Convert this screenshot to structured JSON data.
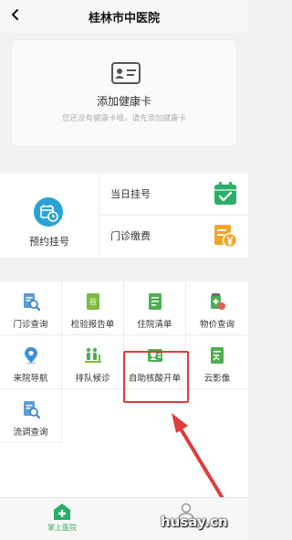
{
  "header": {
    "title": "桂林市中医院",
    "back_icon": "chevron-left-icon"
  },
  "health_card": {
    "title": "添加健康卡",
    "subtitle": "您还没有健康卡哦，请先添加健康卡",
    "icon": "id-card-icon"
  },
  "appointment": {
    "label": "预约挂号",
    "icon": "calendar-clock-icon"
  },
  "side_items": [
    {
      "label": "当日挂号",
      "icon": "calendar-check-icon"
    },
    {
      "label": "门诊缴费",
      "icon": "yen-payment-icon"
    }
  ],
  "services": [
    {
      "label": "门诊查询",
      "icon": "doc-search-icon",
      "color": "#5b9bd5"
    },
    {
      "label": "检验报告单",
      "icon": "test-report-icon",
      "color": "#4caf50"
    },
    {
      "label": "住院清单",
      "icon": "checklist-icon",
      "color": "#4caf50"
    },
    {
      "label": "物价查询",
      "icon": "medicine-price-icon",
      "color": "#4caf50"
    },
    {
      "label": "来院导航",
      "icon": "location-pin-icon",
      "color": "#3a8fd8"
    },
    {
      "label": "排队候诊",
      "icon": "queue-icon",
      "color": "#4caf50"
    },
    {
      "label": "自助核酸开单",
      "icon": "self-order-icon",
      "color": "#4caf50"
    },
    {
      "label": "云影像",
      "icon": "cloud-image-icon",
      "color": "#4caf50"
    },
    {
      "label": "流调查询",
      "icon": "flow-search-icon",
      "color": "#5b9bd5"
    }
  ],
  "tabbar": [
    {
      "label": "掌上医院",
      "icon": "hospital-home-icon",
      "active": true
    },
    {
      "label": "",
      "icon": "user-icon",
      "active": false
    }
  ],
  "watermark": "husay.cn",
  "colors": {
    "accent": "#2aae67",
    "blue": "#29a3d6",
    "highlight": "#e03c3c"
  }
}
